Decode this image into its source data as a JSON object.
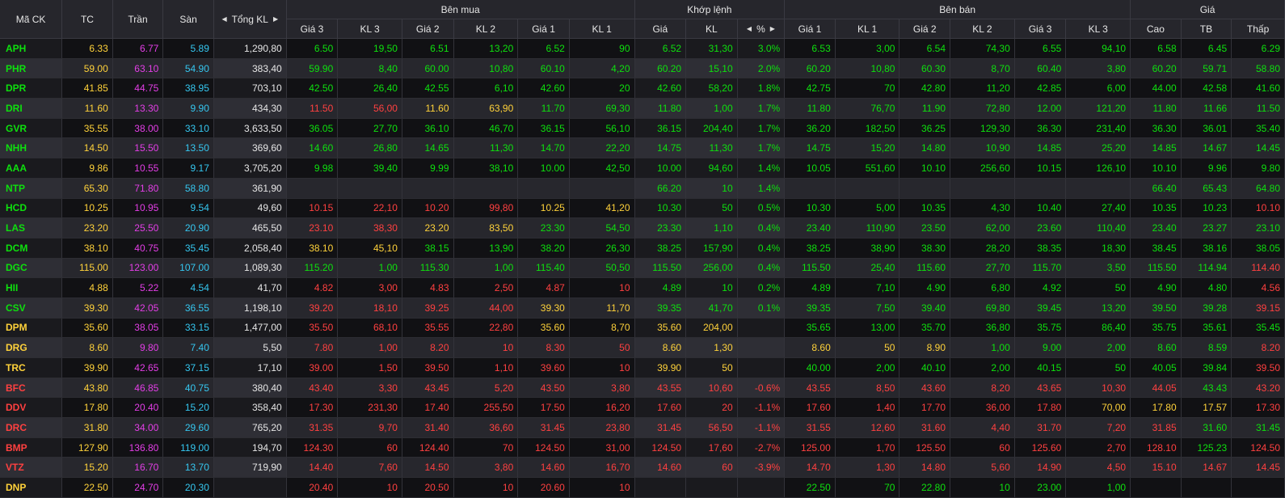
{
  "header": {
    "groups": [
      "Bên mua",
      "Khớp lệnh",
      "Bên bán",
      "Giá"
    ],
    "cols_top": [
      "Mã CK",
      "TC",
      "Trần",
      "Sàn",
      "Tổng KL"
    ],
    "buy": [
      "Giá 3",
      "KL 3",
      "Giá 2",
      "KL 2",
      "Giá 1",
      "KL 1"
    ],
    "match": [
      "Giá",
      "KL",
      "%"
    ],
    "sell": [
      "Giá 1",
      "KL 1",
      "Giá 2",
      "KL 2",
      "Giá 3",
      "KL 3"
    ],
    "price": [
      "Cao",
      "TB",
      "Thấp"
    ]
  },
  "colors": {
    "up": "#0ee00e",
    "down": "#ff4040",
    "ref": "#ffd23a",
    "ceil": "#e33ee6",
    "floor": "#35c7f0"
  },
  "rows": [
    {
      "c": "u",
      "v": [
        "APH",
        "6.33",
        "6.77",
        "5.89",
        "1,290,80",
        "6.50",
        "19,50",
        "6.51",
        "13,20",
        "6.52",
        "90",
        "6.52",
        "31,30",
        "3.0%",
        "6.53",
        "3,00",
        "6.54",
        "74,30",
        "6.55",
        "94,10",
        "6.58",
        "6.45",
        "6.29"
      ],
      "k": "uuuuuuuuuuuuuuuuuud"
    },
    {
      "c": "u",
      "v": [
        "PHR",
        "59.00",
        "63.10",
        "54.90",
        "383,40",
        "59.90",
        "8,40",
        "60.00",
        "10,80",
        "60.10",
        "4,20",
        "60.20",
        "15,10",
        "2.0%",
        "60.20",
        "10,80",
        "60.30",
        "8,70",
        "60.40",
        "3,80",
        "60.20",
        "59.71",
        "58.80"
      ],
      "k": "uuuuuuuuuuuuuuuuuud"
    },
    {
      "c": "u",
      "v": [
        "DPR",
        "41.85",
        "44.75",
        "38.95",
        "703,10",
        "42.50",
        "26,40",
        "42.55",
        "6,10",
        "42.60",
        "20",
        "42.60",
        "58,20",
        "1.8%",
        "42.75",
        "70",
        "42.80",
        "11,20",
        "42.85",
        "6,00",
        "44.00",
        "42.58",
        "41.60"
      ],
      "k": "uuuuuuuuuuuuuuuuuud"
    },
    {
      "c": "u",
      "v": [
        "DRI",
        "11.60",
        "13.30",
        "9.90",
        "434,30",
        "11.50",
        "56,00",
        "11.60",
        "63,90",
        "11.70",
        "69,30",
        "11.80",
        "1,00",
        "1.7%",
        "11.80",
        "76,70",
        "11.90",
        "72,80",
        "12.00",
        "121,20",
        "11.80",
        "11.66",
        "11.50"
      ],
      "k": "ddrruuuuuuuuuuuuuud"
    },
    {
      "c": "u",
      "v": [
        "GVR",
        "35.55",
        "38.00",
        "33.10",
        "3,633,50",
        "36.05",
        "27,70",
        "36.10",
        "46,70",
        "36.15",
        "56,10",
        "36.15",
        "204,40",
        "1.7%",
        "36.20",
        "182,50",
        "36.25",
        "129,30",
        "36.30",
        "231,40",
        "36.30",
        "36.01",
        "35.40"
      ],
      "k": "uuuuuuuuuuuuuuuuuud"
    },
    {
      "c": "u",
      "v": [
        "NHH",
        "14.50",
        "15.50",
        "13.50",
        "369,60",
        "14.60",
        "26,80",
        "14.65",
        "11,30",
        "14.70",
        "22,20",
        "14.75",
        "11,30",
        "1.7%",
        "14.75",
        "15,20",
        "14.80",
        "10,90",
        "14.85",
        "25,20",
        "14.85",
        "14.67",
        "14.45"
      ],
      "k": "uuuuuuuuuuuuuuuuuud"
    },
    {
      "c": "u",
      "v": [
        "AAA",
        "9.86",
        "10.55",
        "9.17",
        "3,705,20",
        "9.98",
        "39,40",
        "9.99",
        "38,10",
        "10.00",
        "42,50",
        "10.00",
        "94,60",
        "1.4%",
        "10.05",
        "551,60",
        "10.10",
        "256,60",
        "10.15",
        "126,10",
        "10.10",
        "9.96",
        "9.80"
      ],
      "k": "uuuuuuuuuuuuuuuuuud"
    },
    {
      "c": "u",
      "v": [
        "NTP",
        "65.30",
        "71.80",
        "58.80",
        "361,90",
        "",
        "",
        "",
        "",
        "",
        "",
        "66.20",
        "10",
        "1.4%",
        "",
        "",
        "",
        "",
        "",
        "",
        "66.40",
        "65.43",
        "64.80"
      ],
      "k": "uuuuuuuuuuuuuuuuuud"
    },
    {
      "c": "u",
      "v": [
        "HCD",
        "10.25",
        "10.95",
        "9.54",
        "49,60",
        "10.15",
        "22,10",
        "10.20",
        "99,80",
        "10.25",
        "41,20",
        "10.30",
        "50",
        "0.5%",
        "10.30",
        "5,00",
        "10.35",
        "4,30",
        "10.40",
        "27,40",
        "10.35",
        "10.23",
        "10.10"
      ],
      "k": "ddddrruuuuuuuuuuudd"
    },
    {
      "c": "u",
      "v": [
        "LAS",
        "23.20",
        "25.50",
        "20.90",
        "465,50",
        "23.10",
        "38,30",
        "23.20",
        "83,50",
        "23.30",
        "54,50",
        "23.30",
        "1,10",
        "0.4%",
        "23.40",
        "110,90",
        "23.50",
        "62,00",
        "23.60",
        "110,40",
        "23.40",
        "23.27",
        "23.10"
      ],
      "k": "ddrruuuuuuuuuuuuuud"
    },
    {
      "c": "u",
      "v": [
        "DCM",
        "38.10",
        "40.75",
        "35.45",
        "2,058,40",
        "38.10",
        "45,10",
        "38.15",
        "13,90",
        "38.20",
        "26,30",
        "38.25",
        "157,90",
        "0.4%",
        "38.25",
        "38,90",
        "38.30",
        "28,20",
        "38.35",
        "18,30",
        "38.45",
        "38.16",
        "38.05"
      ],
      "k": "rruuuuuuuuuuuuuuuud"
    },
    {
      "c": "u",
      "v": [
        "DGC",
        "115.00",
        "123.00",
        "107.00",
        "1,089,30",
        "115.20",
        "1,00",
        "115.30",
        "1,00",
        "115.40",
        "50,50",
        "115.50",
        "256,00",
        "0.4%",
        "115.50",
        "25,40",
        "115.60",
        "27,70",
        "115.70",
        "3,50",
        "115.50",
        "114.94",
        "114.40"
      ],
      "k": "uuuuuuuuuuuuuuuuudd"
    },
    {
      "c": "u",
      "v": [
        "HII",
        "4.88",
        "5.22",
        "4.54",
        "41,70",
        "4.82",
        "3,00",
        "4.83",
        "2,50",
        "4.87",
        "10",
        "4.89",
        "10",
        "0.2%",
        "4.89",
        "7,10",
        "4.90",
        "6,80",
        "4.92",
        "50",
        "4.90",
        "4.80",
        "4.56"
      ],
      "k": "dddddduuuuuuuuuuudd"
    },
    {
      "c": "u",
      "v": [
        "CSV",
        "39.30",
        "42.05",
        "36.55",
        "1,198,10",
        "39.20",
        "18,10",
        "39.25",
        "44,00",
        "39.30",
        "11,70",
        "39.35",
        "41,70",
        "0.1%",
        "39.35",
        "7,50",
        "39.40",
        "69,80",
        "39.45",
        "13,20",
        "39.50",
        "39.28",
        "39.15"
      ],
      "k": "ddddrruuuuuuuuuuudd"
    },
    {
      "c": "r",
      "v": [
        "DPM",
        "35.60",
        "38.05",
        "33.15",
        "1,477,00",
        "35.50",
        "68,10",
        "35.55",
        "22,80",
        "35.60",
        "8,70",
        "35.60",
        "204,00",
        "",
        "35.65",
        "13,00",
        "35.70",
        "36,80",
        "35.75",
        "86,40",
        "35.75",
        "35.61",
        "35.45"
      ],
      "k": "ddddrrrruuuuuuuuuud"
    },
    {
      "c": "r",
      "v": [
        "DRG",
        "8.60",
        "9.80",
        "7.40",
        "5,50",
        "7.80",
        "1,00",
        "8.20",
        "10",
        "8.30",
        "50",
        "8.60",
        "1,30",
        "",
        "8.60",
        "50",
        "8.90",
        "1,00",
        "9.00",
        "2,00",
        "8.60",
        "8.59",
        "8.20"
      ],
      "k": "ddddddrrrrrruuuuudd"
    },
    {
      "c": "r",
      "v": [
        "TRC",
        "39.90",
        "42.65",
        "37.15",
        "17,10",
        "39.00",
        "1,50",
        "39.50",
        "1,10",
        "39.60",
        "10",
        "39.90",
        "50",
        "",
        "40.00",
        "2,00",
        "40.10",
        "2,00",
        "40.15",
        "50",
        "40.05",
        "39.84",
        "39.50"
      ],
      "k": "ddddddrrruuuuuuuudd"
    },
    {
      "c": "d",
      "v": [
        "BFC",
        "43.80",
        "46.85",
        "40.75",
        "380,40",
        "43.40",
        "3,30",
        "43.45",
        "5,20",
        "43.50",
        "3,80",
        "43.55",
        "10,60",
        "-0.6%",
        "43.55",
        "8,50",
        "43.60",
        "8,20",
        "43.65",
        "10,30",
        "44.05",
        "43.43",
        "43.20"
      ],
      "k": "ddddddddddddddddudd"
    },
    {
      "c": "d",
      "v": [
        "DDV",
        "17.80",
        "20.40",
        "15.20",
        "358,40",
        "17.30",
        "231,30",
        "17.40",
        "255,50",
        "17.50",
        "16,20",
        "17.60",
        "20",
        "-1.1%",
        "17.60",
        "1,40",
        "17.70",
        "36,00",
        "17.80",
        "70,00",
        "17.80",
        "17.57",
        "17.30"
      ],
      "k": "ddddddddddddddrrrdd"
    },
    {
      "c": "d",
      "v": [
        "DRC",
        "31.80",
        "34.00",
        "29.60",
        "765,20",
        "31.35",
        "9,70",
        "31.40",
        "36,60",
        "31.45",
        "23,80",
        "31.45",
        "56,50",
        "-1.1%",
        "31.55",
        "12,60",
        "31.60",
        "4,40",
        "31.70",
        "7,20",
        "31.85",
        "31.60",
        "31.45"
      ],
      "k": "dddddddddddddddduud"
    },
    {
      "c": "d",
      "v": [
        "BMP",
        "127.90",
        "136.80",
        "119.00",
        "194,70",
        "124.30",
        "60",
        "124.40",
        "70",
        "124.50",
        "31,00",
        "124.50",
        "17,60",
        "-2.7%",
        "125.00",
        "1,70",
        "125.50",
        "60",
        "125.60",
        "2,70",
        "128.10",
        "125.23",
        "124.50"
      ],
      "k": "ddddddddddddddddudd"
    },
    {
      "c": "d",
      "v": [
        "VTZ",
        "15.20",
        "16.70",
        "13.70",
        "719,90",
        "14.40",
        "7,60",
        "14.50",
        "3,80",
        "14.60",
        "16,70",
        "14.60",
        "60",
        "-3.9%",
        "14.70",
        "1,30",
        "14.80",
        "5,60",
        "14.90",
        "4,50",
        "15.10",
        "14.67",
        "14.45"
      ],
      "k": "ddddddddddddddddddd"
    },
    {
      "c": "r",
      "v": [
        "DNP",
        "22.50",
        "24.70",
        "20.30",
        "",
        "20.40",
        "10",
        "20.50",
        "10",
        "20.60",
        "10",
        "",
        "",
        "",
        "22.50",
        "70",
        "22.80",
        "10",
        "23.00",
        "1,00",
        "",
        "",
        ""
      ],
      "k": "dddddduuuuuuuuuuuuu"
    }
  ]
}
